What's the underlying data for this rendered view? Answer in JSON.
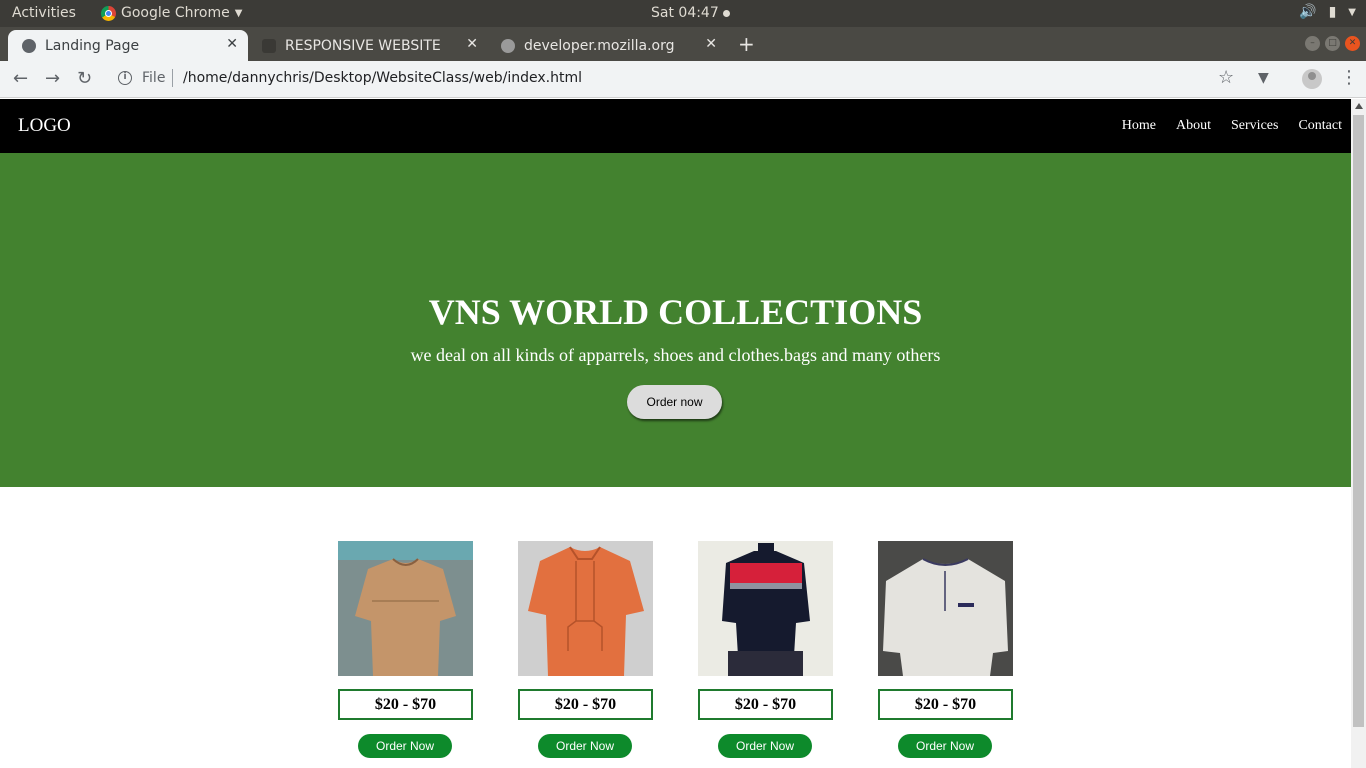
{
  "system_bar": {
    "activities": "Activities",
    "app_name": "Google Chrome",
    "clock": "Sat 04:47"
  },
  "browser": {
    "tabs": [
      {
        "title": "Landing Page",
        "active": true
      },
      {
        "title": "RESPONSIVE WEBSITE",
        "active": false
      },
      {
        "title": "developer.mozilla.org",
        "active": false
      }
    ],
    "address": {
      "scheme_label": "File",
      "url": "/home/dannychris/Desktop/WebsiteClass/web/index.html"
    }
  },
  "site": {
    "logo": "LOGO",
    "nav": [
      "Home",
      "About",
      "Services",
      "Contact"
    ],
    "hero": {
      "title": "VNS WORLD COLLECTIONS",
      "subtitle": "we deal on all kinds of apparrels, shoes and clothes.bags and many others",
      "cta": "Order now",
      "bg_color": "#43822f"
    },
    "products": [
      {
        "price": "$20 - $70",
        "button": "Order Now",
        "image": "tan-kaftan-shirt"
      },
      {
        "price": "$20 - $70",
        "button": "Order Now",
        "image": "orange-kaftan-shirt"
      },
      {
        "price": "$20 - $70",
        "button": "Order Now",
        "image": "black-red-shirt"
      },
      {
        "price": "$20 - $70",
        "button": "Order Now",
        "image": "white-kaftan-shirt"
      }
    ]
  }
}
